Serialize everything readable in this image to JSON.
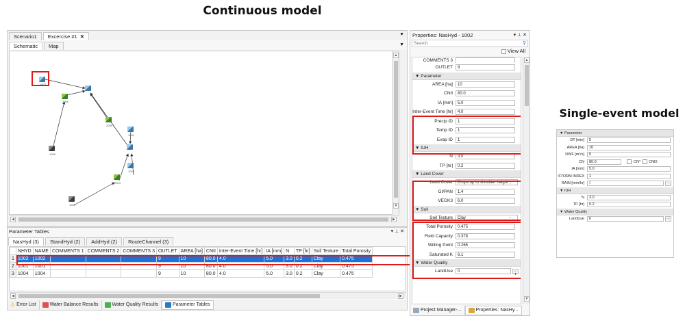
{
  "titles": {
    "continuous": "Continuous model",
    "single_event": "Single-event model"
  },
  "doc_tabs": [
    "Scenario1",
    "Excercise #1"
  ],
  "view_tabs": [
    "Schematic",
    "Map"
  ],
  "nodes": [
    {
      "id": "1002",
      "color": "blue"
    },
    {
      "id": "2006",
      "color": "green"
    },
    {
      "id": "2005",
      "color": "green"
    },
    {
      "id": "1001",
      "color": "blue"
    },
    {
      "id": "1005",
      "color": "dark"
    },
    {
      "id": "1004",
      "color": "blue"
    },
    {
      "id": "2004",
      "color": "green"
    },
    {
      "id": "1003",
      "color": "dark"
    }
  ],
  "param_panel": {
    "title": "Parameter Tables",
    "tabs": [
      "NasHyd (3)",
      "StandHyd (2)",
      "AddHyd (2)",
      "RouteChannel (3)"
    ],
    "columns": [
      "NHYD",
      "NAME",
      "COMMENTS 1",
      "COMMENTS 2",
      "COMMENTS 3",
      "OUTLET",
      "AREA [ha]",
      "CNII",
      "Inter-Event Time [hr]",
      "IA [mm]",
      "N",
      "TP [hr]",
      "Soil Texture",
      "Total Porosity"
    ],
    "rows": [
      {
        "num": "1",
        "cells": [
          "1002",
          "1002",
          "",
          "",
          "",
          "9",
          "10",
          "80.0",
          "4.0",
          "5.0",
          "3.0",
          "0.2",
          "Clay",
          "0.475"
        ]
      },
      {
        "num": "2",
        "cells": [
          "1001",
          "1001",
          "",
          "",
          "",
          "9",
          "10",
          "80.0",
          "4.0",
          "5.0",
          "3.0",
          "0.2",
          "Clay",
          "0.475"
        ]
      },
      {
        "num": "3",
        "cells": [
          "1004",
          "1004",
          "",
          "",
          "",
          "9",
          "10",
          "80.0",
          "4.0",
          "5.0",
          "3.0",
          "0.2",
          "Clay",
          "0.475"
        ]
      }
    ]
  },
  "bottom_tabs": [
    "Error List",
    "Water Balance Results",
    "Water Quality Results",
    "Parameter Tables"
  ],
  "properties": {
    "title": "Properties: NasHyd - 1002",
    "search_placeholder": "Search",
    "view_all": "View All",
    "cut_label": "COMMENTS 3",
    "outlet_label": "OUTLET",
    "outlet_value": "9",
    "sections": {
      "parameter": "Parameter",
      "iuh": "IUH",
      "land_cover": "Land Cover",
      "soil": "Soil",
      "water_quality": "Water Quality"
    },
    "parameter": [
      {
        "label": "AREA [ha]",
        "value": "10"
      },
      {
        "label": "CNII",
        "value": "80.0"
      },
      {
        "label": "IA [mm]",
        "value": "5.0"
      },
      {
        "label": "Inter-Event Time [hr]",
        "value": "4.0"
      },
      {
        "label": "Precip ID",
        "value": "1"
      },
      {
        "label": "Temp ID",
        "value": "1"
      },
      {
        "label": "Evap ID",
        "value": "1"
      }
    ],
    "iuh": [
      {
        "label": "N",
        "value": "3.0"
      },
      {
        "label": "TP [hr]",
        "value": "0.2"
      }
    ],
    "land_cover": [
      {
        "label": "Land Cover",
        "value": "Crops up to shoulder height"
      },
      {
        "label": "GI/PAN",
        "value": "1.4"
      },
      {
        "label": "VEGK3",
        "value": "6.0"
      }
    ],
    "soil": [
      {
        "label": "Soil Texture",
        "value": "Clay"
      },
      {
        "label": "Total Porosity",
        "value": "0.475"
      },
      {
        "label": "Field Capacity",
        "value": "0.378"
      },
      {
        "label": "Wilting Point",
        "value": "0.265"
      },
      {
        "label": "Saturated K",
        "value": "6.1"
      }
    ],
    "water_quality": [
      {
        "label": "LandUse",
        "value": "0"
      }
    ],
    "footer_tabs": [
      "Project Manager-...",
      "Properties: NasHy..."
    ]
  },
  "single_event": {
    "sections": {
      "parameter": "Parameter",
      "iuh": "IUH",
      "water_quality": "Water Quality"
    },
    "parameter": [
      {
        "label": "DT [min]",
        "value": "5"
      },
      {
        "label": "AREA [ha]",
        "value": "10"
      },
      {
        "label": "DWF [m³/s]",
        "value": "0"
      },
      {
        "label": "CN",
        "value": "80.0"
      },
      {
        "label": "IA [mm]",
        "value": "5.0"
      },
      {
        "label": "STORM INDEX",
        "value": "1"
      },
      {
        "label": "RAIN [mm/hr]",
        "value": "0"
      }
    ],
    "cn_star": "CN*",
    "cniii": "CNIII",
    "iuh": [
      {
        "label": "N",
        "value": "3.0"
      },
      {
        "label": "TP [hr]",
        "value": "0.2"
      }
    ],
    "water_quality": [
      {
        "label": "LandUse",
        "value": "0"
      }
    ]
  }
}
